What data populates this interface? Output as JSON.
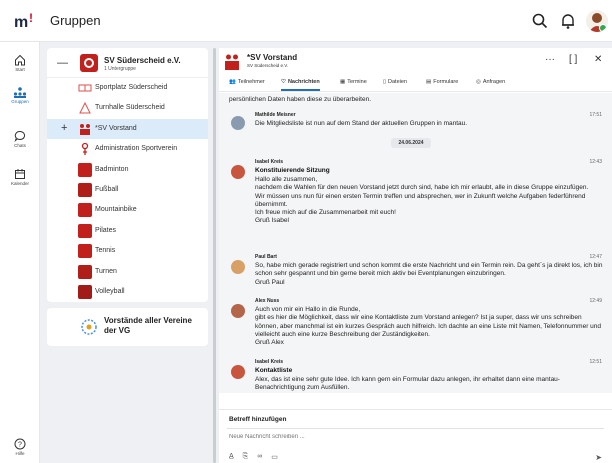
{
  "app": {
    "title": "Gruppen"
  },
  "nav": [
    {
      "label": "Start",
      "icon": "home-icon"
    },
    {
      "label": "Gruppen",
      "icon": "groups-icon",
      "active": true
    },
    {
      "label": "Chats",
      "icon": "chat-icon"
    },
    {
      "label": "Kalender",
      "icon": "calendar-icon"
    },
    {
      "label": "Hilfe",
      "icon": "help-icon"
    }
  ],
  "groups": {
    "main": {
      "name": "SV Süderscheid e.V.",
      "sub": "1 Untergruppe"
    },
    "items": [
      {
        "label": "Sportplatz Süderscheid",
        "icon": "field-icon"
      },
      {
        "label": "Turnhalle Süderscheid",
        "icon": "gym-icon"
      },
      {
        "label": "*SV Vorstand",
        "icon": "board-icon"
      },
      {
        "label": "Administration Sportverein",
        "icon": "admin-icon"
      },
      {
        "label": "Badminton",
        "icon": "badminton-icon"
      },
      {
        "label": "Fußball",
        "icon": "football-icon"
      },
      {
        "label": "Mountainbike",
        "icon": "bike-icon"
      },
      {
        "label": "Pilates",
        "icon": "pilates-icon"
      },
      {
        "label": "Tennis",
        "icon": "tennis-icon"
      },
      {
        "label": "Turnen",
        "icon": "gymnastics-icon"
      },
      {
        "label": "Volleyball",
        "icon": "volleyball-icon"
      }
    ],
    "second": {
      "name": "Vorstände aller Vereine der VG"
    }
  },
  "chat": {
    "title": "*SV Vorstand",
    "subtitle": "SV Süderscheid e.V.",
    "header_icons": {
      "more": "···",
      "expand": "[ ]",
      "close": "✕"
    },
    "tabs": [
      "Teilnehmer",
      "Nachrichten",
      "Termine",
      "Dateien",
      "Formulare",
      "Anfragen"
    ],
    "tab_icons": [
      "👥",
      "♡",
      "▦",
      "▯",
      "▤",
      "◎"
    ],
    "cut_text": "persönlichen Daten haben diese zu überarbeiten.",
    "date": "24.06.2024",
    "messages": [
      {
        "author": "Mathilde Meisner",
        "time": "17:51",
        "title": "",
        "body": "Die Mitgliedsliste ist nun auf dem Stand der aktuellen Gruppen in mantau."
      },
      {
        "author": "Isabel Kreis",
        "time": "12:43",
        "title": "Konstituierende Sitzung",
        "body": "Hallo alle zusammen,\nnachdem die Wahlen für den neuen Vorstand jetzt durch sind, habe ich mir erlaubt, alle in diese Gruppe einzufügen.\nWir müssen uns nun für einen ersten Termin treffen und absprechen, wer in Zukunft welche Aufgaben federführend übernimmt.\nIch freue mich auf die Zusammenarbeit mit euch!\nGruß Isabel"
      },
      {
        "author": "Paul Bart",
        "time": "12:47",
        "title": "",
        "body": "So, habe mich gerade registriert und schon kommt die erste Nachricht und ein Termin rein. Da geht´s ja direkt los, ich bin schon sehr gespannt und bin gerne bereit mich aktiv bei Eventplanungen einzubringen.\nGruß Paul"
      },
      {
        "author": "Alex Nuss",
        "time": "12:49",
        "title": "",
        "body": "Auch von mir ein Hallo in die Runde,\ngibt es hier die Möglichkeit, dass wir eine Kontaktliste zum Vorstand anlegen? Ist ja super, dass wir uns schreiben können, aber manchmal ist ein kurzes Gespräch auch hilfreich. Ich dachte an eine Liste mit Namen, Telefonnummer und vielleicht auch eine kurze Beschreibung der Zuständigkeiten.\nGruß Alex"
      },
      {
        "author": "Isabel Kreis",
        "time": "12:51",
        "title": "Kontaktliste",
        "body": "Alex, das ist eine sehr gute Idee. Ich kann gern ein Formular dazu anlegen, ihr erhaltet dann eine mantau-Benachrichtigung zum Ausfüllen."
      }
    ],
    "composer": {
      "subject": "Betreff hinzufügen",
      "placeholder": "Neue Nachricht schreiben ..."
    }
  },
  "colors": {
    "accent": "#1f6fb2",
    "brand_red": "#c0211d",
    "selected_row": "#dcebfa"
  }
}
